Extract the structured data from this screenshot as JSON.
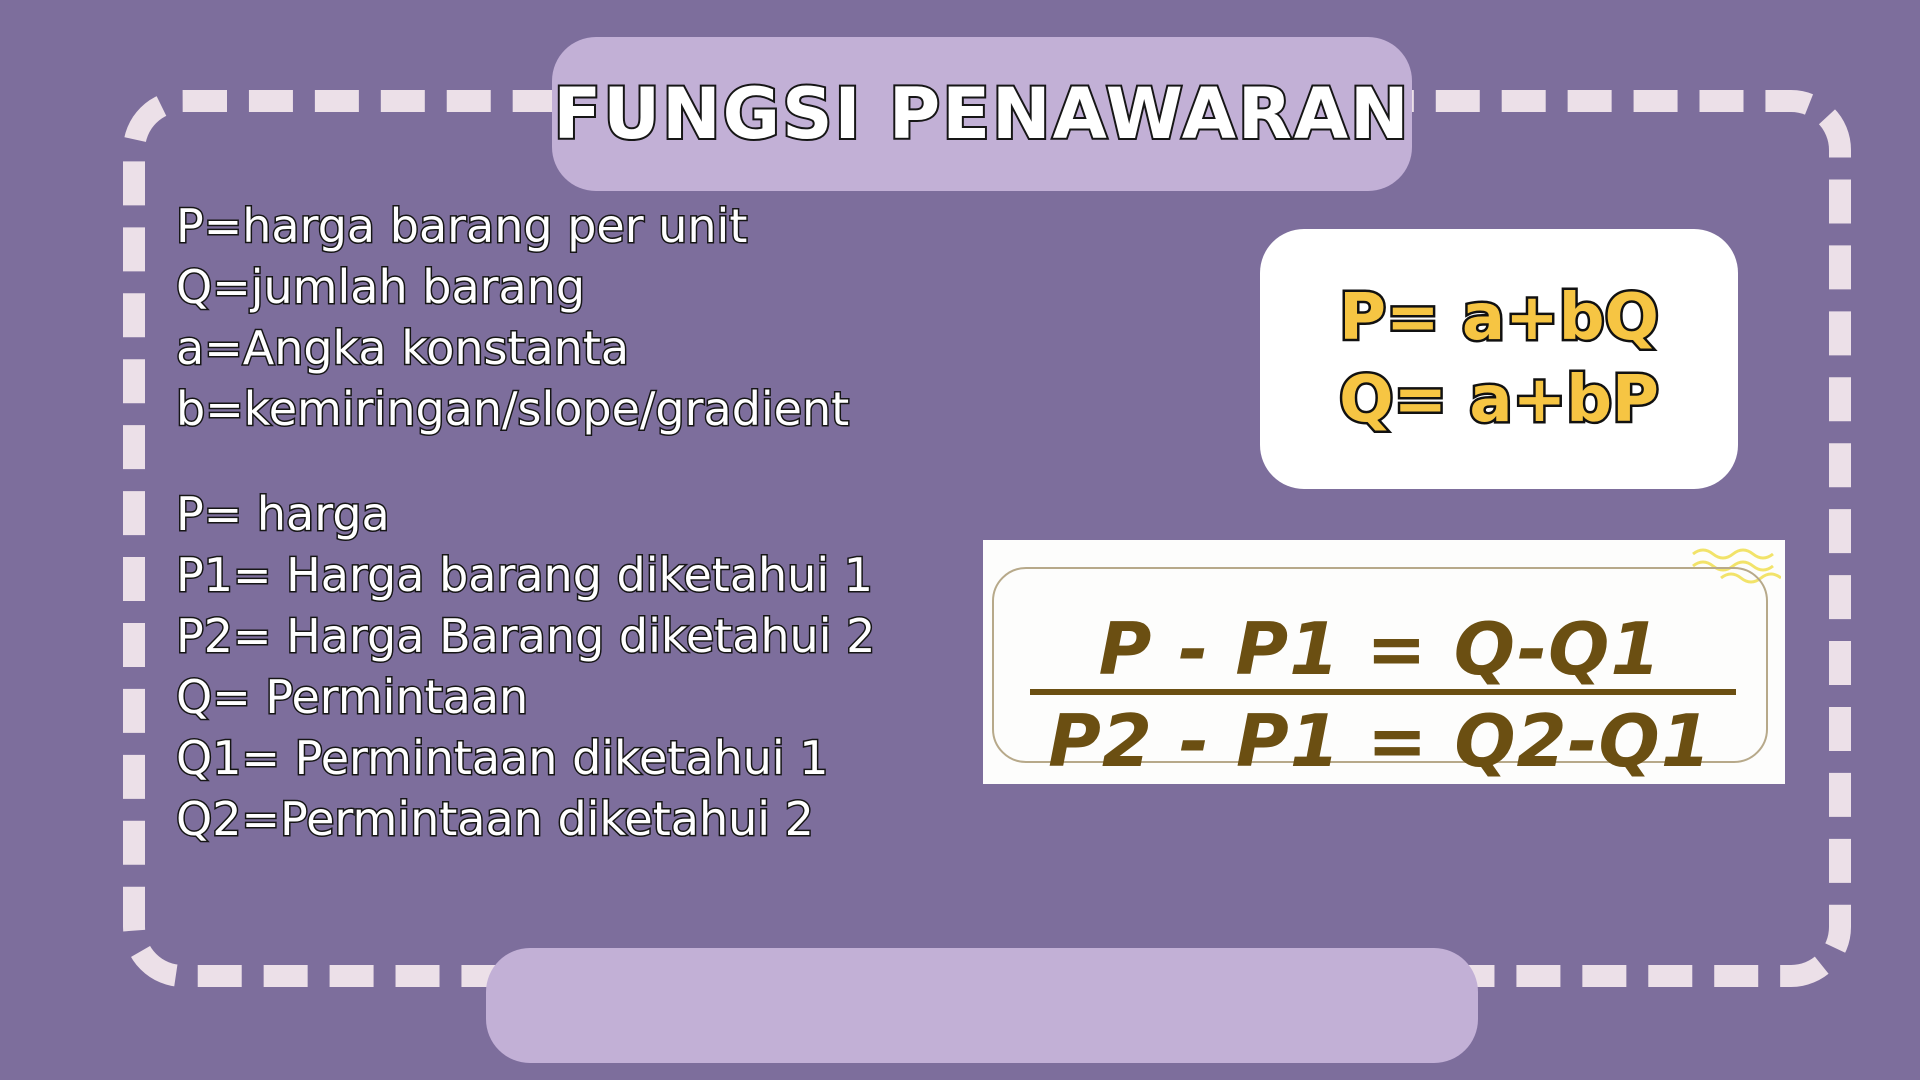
{
  "title": "FUNGSI PENAWARAN",
  "definitions": [
    "P=harga barang per unit",
    "Q=jumlah barang",
    "a=Angka konstanta",
    "b=kemiringan/slope/gradient"
  ],
  "variables": [
    "P= harga",
    "P1= Harga barang diketahui 1",
    "P2= Harga Barang diketahui 2",
    "Q= Permintaan",
    "Q1= Permintaan diketahui 1",
    "Q2=Permintaan diketahui 2"
  ],
  "formulas": {
    "line1": "P= a+bQ",
    "line2": "Q= a+bP"
  },
  "fraction": {
    "numerator": "P - P1 = Q-Q1",
    "denominator": "P2 - P1 = Q2-Q1"
  },
  "colors": {
    "background": "#7d6e9c",
    "pill": "#c2b0d6",
    "dash": "#ece0e8",
    "formula_text": "#f6c543",
    "fraction_text": "#6b4f12"
  }
}
